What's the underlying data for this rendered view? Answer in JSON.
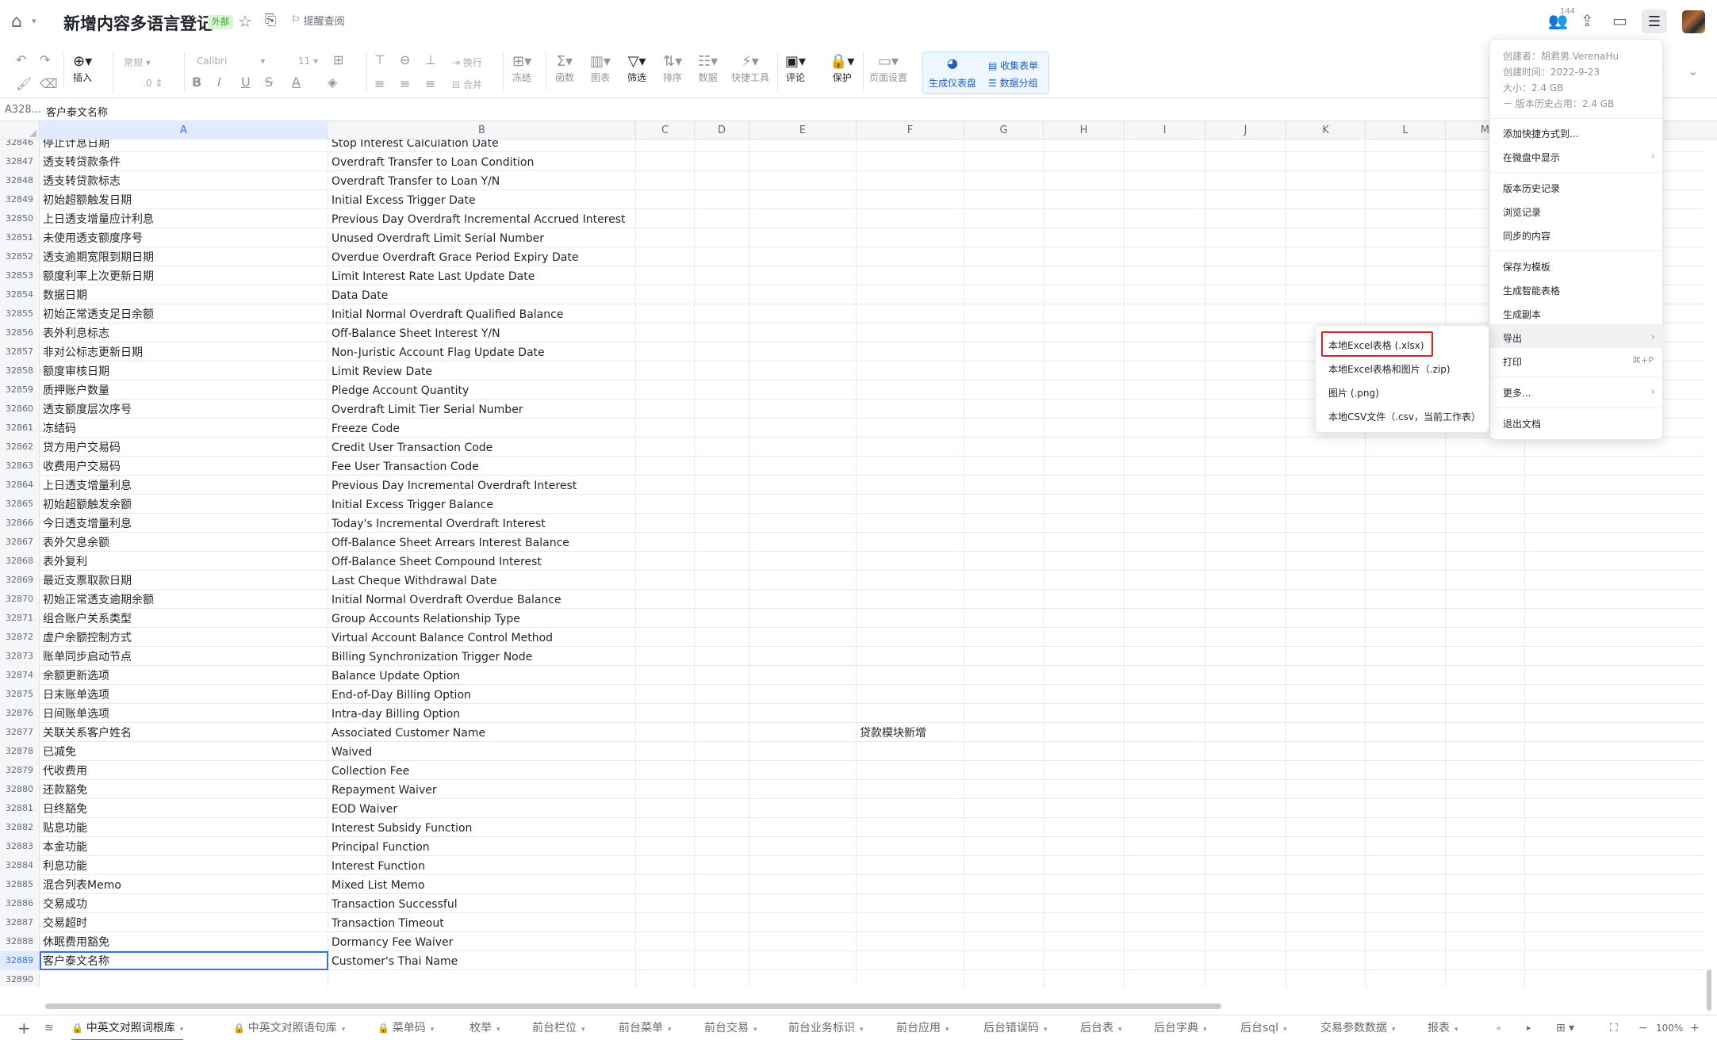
{
  "title_bar": {
    "doc_title": "新增内容多语言登记",
    "external_badge": "外部",
    "remind_label": "提醒查阅",
    "collaborator_count": "144"
  },
  "toolbar": {
    "insert": "插入",
    "format_select": "常规",
    "decimal": ".0",
    "font_select": "Calibri",
    "font_size": "11",
    "wrap": "换行",
    "merge": "合并",
    "freeze": "冻结",
    "function": "函数",
    "chart": "图表",
    "filter": "筛选",
    "sort": "排序",
    "data": "数据",
    "quick_tools": "快捷工具",
    "comment": "评论",
    "protect": "保护",
    "page_settings": "页面设置",
    "generate_dashboard": "生成仪表盘",
    "collect_form": "收集表单",
    "data_group": "数据分组"
  },
  "formula_bar": {
    "cell_ref": "A328...",
    "value": "客户泰文名称"
  },
  "columns": [
    "A",
    "B",
    "C",
    "D",
    "E",
    "F",
    "G",
    "H",
    "I",
    "J",
    "K",
    "L",
    "M"
  ],
  "rows": [
    {
      "n": "32846",
      "a": "停止计息日期",
      "b": "Stop Interest Calculation Date",
      "f": ""
    },
    {
      "n": "32847",
      "a": "透支转贷款条件",
      "b": "Overdraft Transfer to Loan Condition",
      "f": ""
    },
    {
      "n": "32848",
      "a": "透支转贷款标志",
      "b": "Overdraft Transfer to Loan Y/N",
      "f": ""
    },
    {
      "n": "32849",
      "a": "初始超额触发日期",
      "b": "Initial Excess Trigger Date",
      "f": ""
    },
    {
      "n": "32850",
      "a": "上日透支增量应计利息",
      "b": "Previous Day Overdraft Incremental Accrued Interest",
      "f": ""
    },
    {
      "n": "32851",
      "a": "未使用透支额度序号",
      "b": "Unused Overdraft Limit Serial Number",
      "f": ""
    },
    {
      "n": "32852",
      "a": "透支逾期宽限到期日期",
      "b": "Overdue Overdraft Grace Period Expiry Date",
      "f": ""
    },
    {
      "n": "32853",
      "a": "额度利率上次更新日期",
      "b": "Limit Interest Rate Last Update Date",
      "f": ""
    },
    {
      "n": "32854",
      "a": "数据日期",
      "b": "Data Date",
      "f": ""
    },
    {
      "n": "32855",
      "a": "初始正常透支足日余额",
      "b": "Initial Normal Overdraft Qualified Balance",
      "f": ""
    },
    {
      "n": "32856",
      "a": "表外利息标志",
      "b": "Off-Balance Sheet Interest Y/N",
      "f": ""
    },
    {
      "n": "32857",
      "a": "非对公标志更新日期",
      "b": "Non-Juristic Account Flag Update Date",
      "f": ""
    },
    {
      "n": "32858",
      "a": "额度审核日期",
      "b": "Limit Review Date",
      "f": ""
    },
    {
      "n": "32859",
      "a": "质押账户数量",
      "b": "Pledge Account Quantity",
      "f": ""
    },
    {
      "n": "32860",
      "a": "透支额度层次序号",
      "b": "Overdraft Limit Tier Serial Number",
      "f": ""
    },
    {
      "n": "32861",
      "a": "冻结码",
      "b": "Freeze Code",
      "f": ""
    },
    {
      "n": "32862",
      "a": "贷方用户交易码",
      "b": "Credit User Transaction Code",
      "f": ""
    },
    {
      "n": "32863",
      "a": "收费用户交易码",
      "b": "Fee User Transaction Code",
      "f": ""
    },
    {
      "n": "32864",
      "a": "上日透支增量利息",
      "b": "Previous Day Incremental Overdraft Interest",
      "f": ""
    },
    {
      "n": "32865",
      "a": "初始超额触发余额",
      "b": "Initial Excess Trigger Balance",
      "f": ""
    },
    {
      "n": "32866",
      "a": "今日透支增量利息",
      "b": "Today's Incremental Overdraft Interest",
      "f": ""
    },
    {
      "n": "32867",
      "a": "表外欠息余额",
      "b": "Off-Balance Sheet Arrears Interest Balance",
      "f": ""
    },
    {
      "n": "32868",
      "a": "表外复利",
      "b": "Off-Balance Sheet Compound Interest",
      "f": ""
    },
    {
      "n": "32869",
      "a": "最近支票取款日期",
      "b": "Last Cheque Withdrawal Date",
      "f": ""
    },
    {
      "n": "32870",
      "a": "初始正常透支逾期余额",
      "b": "Initial Normal Overdraft Overdue Balance",
      "f": ""
    },
    {
      "n": "32871",
      "a": "组合账户关系类型",
      "b": "Group Accounts Relationship Type",
      "f": ""
    },
    {
      "n": "32872",
      "a": "虚户余额控制方式",
      "b": "Virtual Account Balance Control Method",
      "f": ""
    },
    {
      "n": "32873",
      "a": "账单同步启动节点",
      "b": "Billing Synchronization Trigger Node",
      "f": ""
    },
    {
      "n": "32874",
      "a": "余额更新选项",
      "b": "Balance Update Option",
      "f": ""
    },
    {
      "n": "32875",
      "a": "日末账单选项",
      "b": "End-of-Day Billing Option",
      "f": ""
    },
    {
      "n": "32876",
      "a": "日间账单选项",
      "b": "Intra-day Billing Option",
      "f": ""
    },
    {
      "n": "32877",
      "a": "关联关系客户姓名",
      "b": "Associated Customer Name",
      "f": "贷款模块新增"
    },
    {
      "n": "32878",
      "a": "已减免",
      "b": "Waived",
      "f": ""
    },
    {
      "n": "32879",
      "a": "代收费用",
      "b": "Collection Fee",
      "f": ""
    },
    {
      "n": "32880",
      "a": "还款豁免",
      "b": "Repayment Waiver",
      "f": ""
    },
    {
      "n": "32881",
      "a": "日终豁免",
      "b": "EOD Waiver",
      "f": ""
    },
    {
      "n": "32882",
      "a": "贴息功能",
      "b": "Interest Subsidy Function",
      "f": ""
    },
    {
      "n": "32883",
      "a": "本金功能",
      "b": "Principal Function",
      "f": ""
    },
    {
      "n": "32884",
      "a": "利息功能",
      "b": "Interest Function",
      "f": ""
    },
    {
      "n": "32885",
      "a": "混合列表Memo",
      "b": "Mixed List Memo",
      "f": ""
    },
    {
      "n": "32886",
      "a": "交易成功",
      "b": "Transaction Successful",
      "f": ""
    },
    {
      "n": "32887",
      "a": "交易超时",
      "b": "Transaction Timeout",
      "f": ""
    },
    {
      "n": "32888",
      "a": "休眠费用豁免",
      "b": "Dormancy Fee Waiver",
      "f": ""
    },
    {
      "n": "32889",
      "a": "客户泰文名称",
      "b": "Customer's Thai Name",
      "f": ""
    },
    {
      "n": "32890",
      "a": "",
      "b": "",
      "f": ""
    }
  ],
  "main_menu": {
    "creator": "创建者：胡君男.VerenaHu",
    "created_time": "创建时间：2022-9-23",
    "size": "大小：2.4 GB",
    "history_size": "－ 版本历史占用：2.4 GB",
    "add_shortcut": "添加快捷方式到...",
    "show_in_drive": "在微盘中显示",
    "version_history": "版本历史记录",
    "browse_history": "浏览记录",
    "synced_content": "同步的内容",
    "save_as_template": "保存为模板",
    "generate_smart_table": "生成智能表格",
    "generate_copy": "生成副本",
    "export": "导出",
    "print": "打印",
    "print_shortcut": "⌘+P",
    "more": "更多...",
    "exit_doc": "退出文档"
  },
  "export_menu": {
    "xlsx": "本地Excel表格 (.xlsx)",
    "zip": "本地Excel表格和图片（.zip)",
    "png": "图片 (.png)",
    "csv": "本地CSV文件（.csv，当前工作表）"
  },
  "sheet_tabs": [
    "中英文对照词根库",
    "中英文对照语句库",
    "菜单码",
    "枚举",
    "前台栏位",
    "前台菜单",
    "前台交易",
    "前台业务标识",
    "前台应用",
    "后台错误码",
    "后台表",
    "后台字典",
    "后台sql",
    "交易参数数据",
    "报表"
  ],
  "zoom": "100%",
  "colors": {
    "accent": "#3370ff",
    "highlight_box": "#e02020",
    "badge_green": "#2ea121"
  }
}
